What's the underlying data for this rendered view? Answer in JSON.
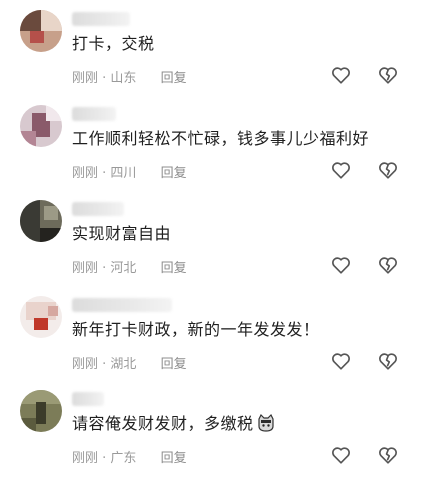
{
  "comments": [
    {
      "username": "",
      "text": "打卡，交税",
      "time": "刚刚",
      "location": "山东",
      "reply_label": "回复",
      "avatar_colors": [
        "#6a4a3d",
        "#c7a08a",
        "#e8d5c8",
        "#b5504a"
      ]
    },
    {
      "username": "",
      "text": "工作顺利轻松不忙碌，钱多事儿少福利好",
      "time": "刚刚",
      "location": "四川",
      "reply_label": "回复",
      "avatar_colors": [
        "#d8c9cf",
        "#8a5a6a",
        "#f1e8ec",
        "#b38594"
      ]
    },
    {
      "username": "",
      "text": "实现财富自由",
      "time": "刚刚",
      "location": "河北",
      "reply_label": "回复",
      "avatar_colors": [
        "#3a3a34",
        "#6d6b5b",
        "#9c9a86",
        "#24231f"
      ]
    },
    {
      "username": "",
      "text": "新年打卡财政，新的一年发发发！",
      "time": "刚刚",
      "location": "湖北",
      "reply_label": "回复",
      "avatar_colors": [
        "#f3ecea",
        "#d6a8a0",
        "#c0392b",
        "#e9d3cc"
      ]
    },
    {
      "username": "",
      "text": "请容俺发财发财，多缴税",
      "time": "刚刚",
      "location": "广东",
      "reply_label": "回复",
      "avatar_colors": [
        "#5b5b3e",
        "#7c7c58",
        "#3c3c2a",
        "#9a9a75"
      ]
    }
  ],
  "icons": {
    "like": "heart-outline-icon",
    "dislike": "broken-heart-outline-icon",
    "emoji": "cat-emoji-icon"
  },
  "colors": {
    "text": "#1f1f1f",
    "meta": "#9a9a9a",
    "icon_stroke": "#555555"
  },
  "watermark": {
    "left": "",
    "right": ""
  }
}
